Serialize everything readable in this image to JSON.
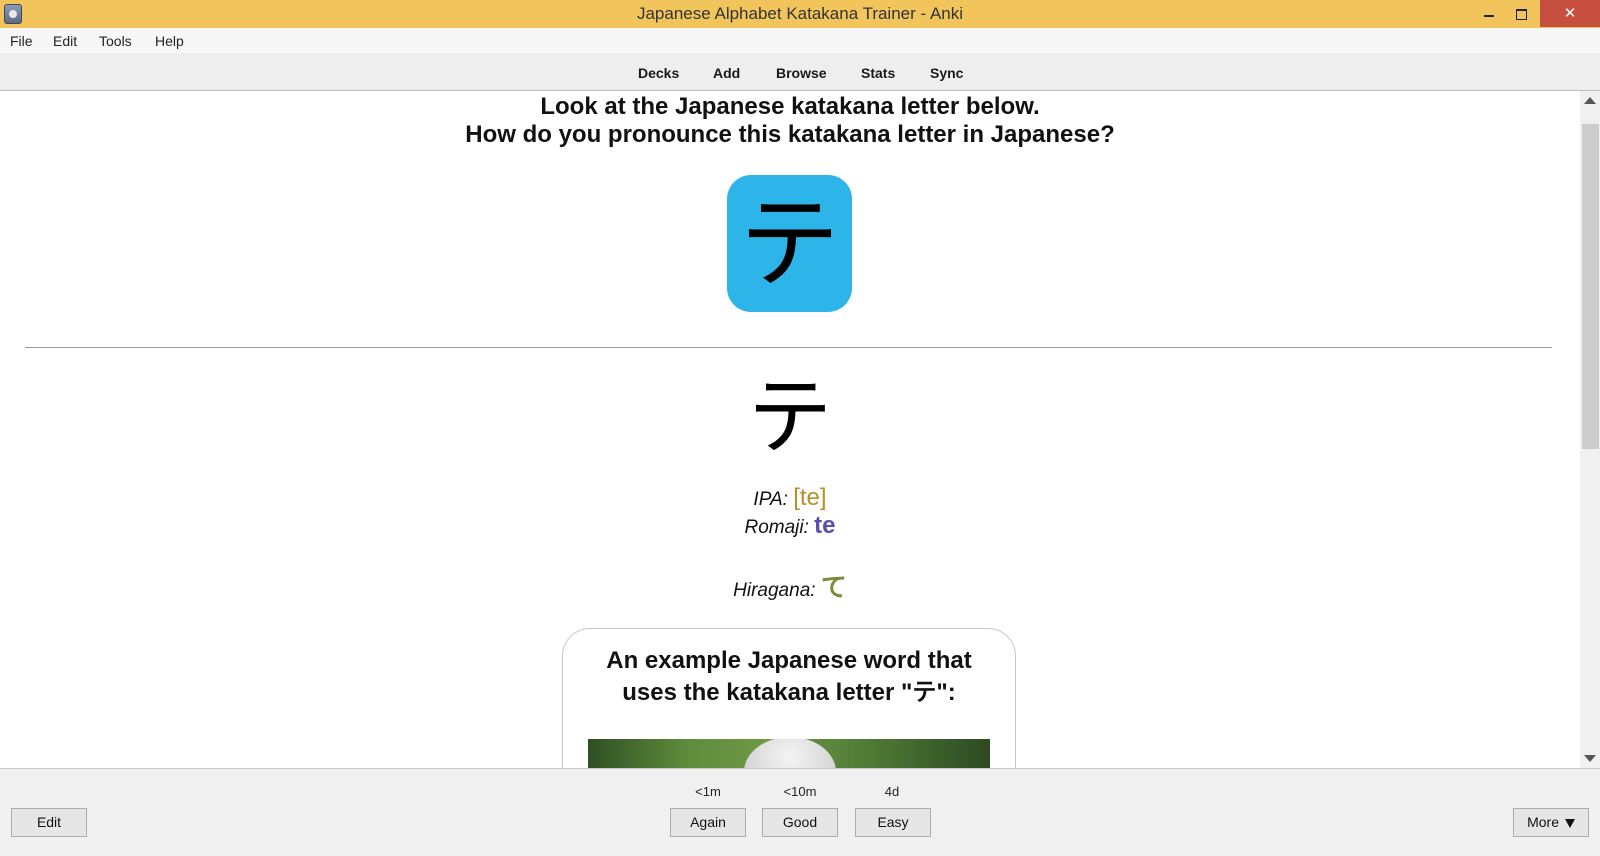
{
  "window": {
    "title": "Japanese Alphabet Katakana Trainer - Anki",
    "close_glyph": "✕"
  },
  "menu": {
    "items": [
      "File",
      "Edit",
      "Tools",
      "Help"
    ]
  },
  "toolbar": {
    "links": [
      "Decks",
      "Add",
      "Browse",
      "Stats",
      "Sync"
    ]
  },
  "card": {
    "question_line1": "Look at the Japanese katakana letter below.",
    "question_line2": "How do you pronounce this katakana letter in Japanese?",
    "kana": "テ",
    "ipa_label": "IPA:",
    "ipa_value": "[te]",
    "romaji_label": "Romaji:",
    "romaji_value": "te",
    "hiragana_label": "Hiragana:",
    "hiragana_value": "て",
    "example_title_line1": "An example Japanese word that",
    "example_title_line2": "uses the katakana letter \"テ\":"
  },
  "colors": {
    "titlebar": "#f2c55c",
    "kana_tile": "#2db5ea",
    "ipa": "#b8902a",
    "romaji": "#5b4cae",
    "hiragana": "#7d8a3a"
  },
  "answer_bar": {
    "edit_label": "Edit",
    "more_label": "More",
    "again_interval": "<1m",
    "again_label": "Again",
    "good_interval": "<10m",
    "good_label": "Good",
    "easy_interval": "4d",
    "easy_label": "Easy"
  }
}
